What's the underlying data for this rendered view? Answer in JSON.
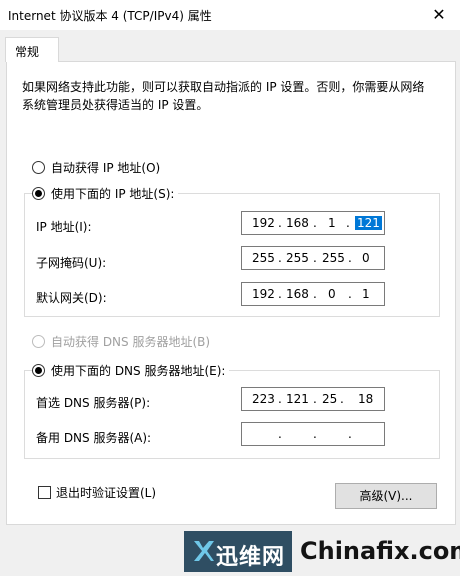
{
  "window": {
    "title": "Internet 协议版本 4 (TCP/IPv4) 属性",
    "close_glyph": "✕"
  },
  "tab": {
    "label": "常规"
  },
  "description": "如果网络支持此功能，则可以获取自动指派的 IP 设置。否则，你需要从网络系统管理员处获得适当的 IP 设置。",
  "ip_section": {
    "auto_label": "自动获得 IP 地址(O)",
    "auto_selected": false,
    "manual_label": "使用下面的 IP 地址(S):",
    "manual_selected": true,
    "fields": [
      {
        "label": "IP 地址(I):",
        "octets": [
          "192",
          "168",
          "1",
          "121"
        ],
        "selected_octet": 3
      },
      {
        "label": "子网掩码(U):",
        "octets": [
          "255",
          "255",
          "255",
          "0"
        ]
      },
      {
        "label": "默认网关(D):",
        "octets": [
          "192",
          "168",
          "0",
          "1"
        ]
      }
    ]
  },
  "dns_section": {
    "auto_label": "自动获得 DNS 服务器地址(B)",
    "auto_enabled": false,
    "manual_label": "使用下面的 DNS 服务器地址(E):",
    "manual_selected": true,
    "fields": [
      {
        "label": "首选 DNS 服务器(P):",
        "octets": [
          "223",
          "121",
          "25",
          "18"
        ]
      },
      {
        "label": "备用 DNS 服务器(A):",
        "octets": [
          "",
          "",
          "",
          ""
        ]
      }
    ]
  },
  "validate_checkbox": {
    "label": "退出时验证设置(L)",
    "checked": false
  },
  "advanced_button": {
    "label": "高级(V)..."
  },
  "watermark": {
    "logo_text": "迅维网",
    "site_text": "Chinafix.com"
  },
  "colors": {
    "selection": "#0078d7",
    "watermark_bg": "#2f4e63",
    "dialog_bg": "#f0f0f0"
  }
}
